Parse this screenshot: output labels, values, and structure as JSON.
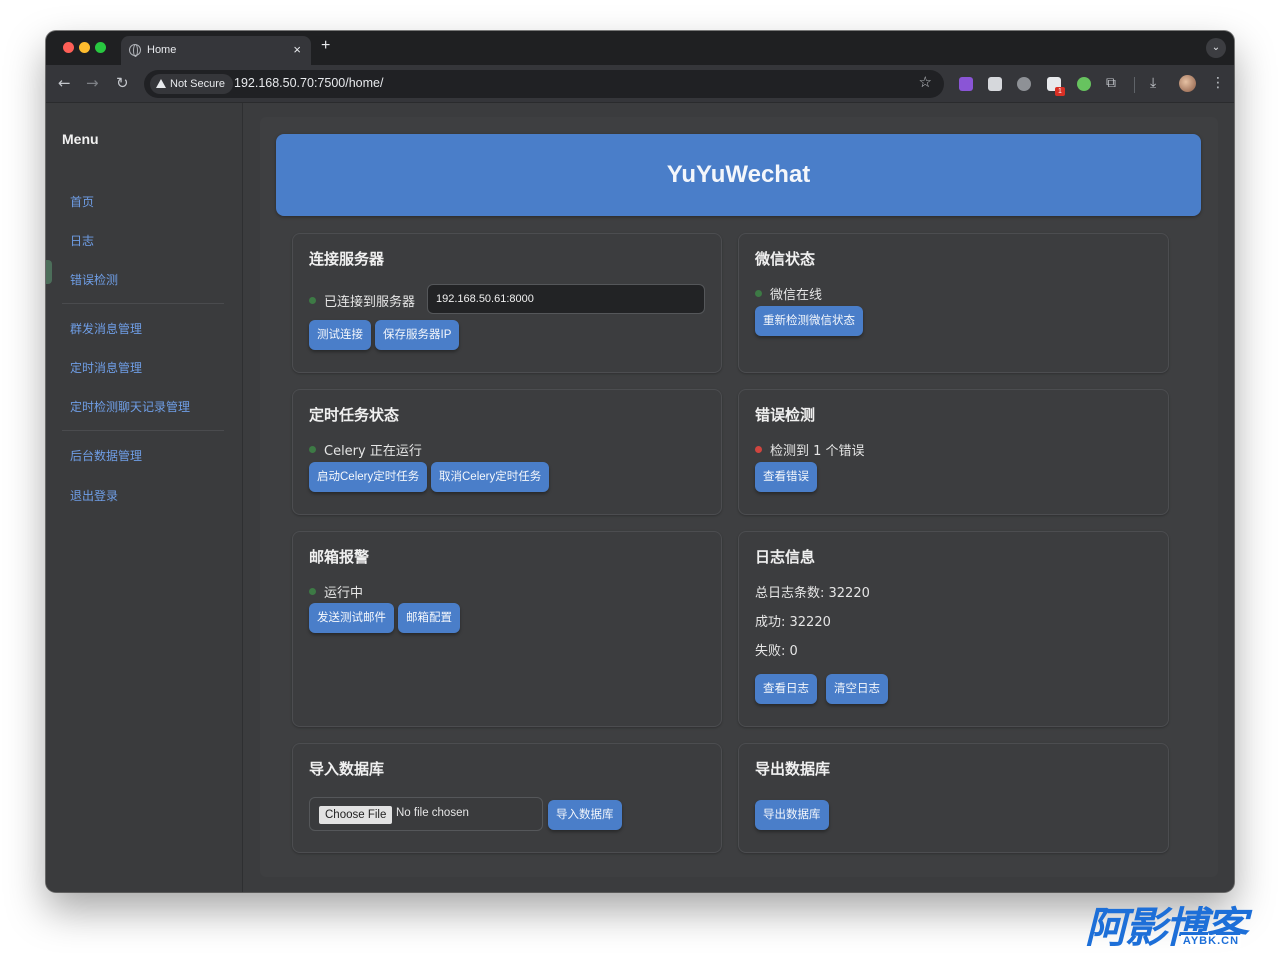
{
  "browser": {
    "tab_title": "Home",
    "tab_close": "×",
    "new_tab": "+",
    "tab_menu": "⌄",
    "security_label": "Not Secure",
    "url": "192.168.50.70:7500/home/",
    "extension_badge": "1"
  },
  "sidebar": {
    "title": "Menu",
    "items": [
      {
        "label": "首页"
      },
      {
        "label": "日志"
      },
      {
        "label": "错误检测"
      },
      {
        "label": "群发消息管理"
      },
      {
        "label": "定时消息管理"
      },
      {
        "label": "定时检测聊天记录管理"
      },
      {
        "label": "后台数据管理"
      },
      {
        "label": "退出登录"
      }
    ]
  },
  "banner": {
    "title": "YuYuWechat"
  },
  "cards": {
    "server": {
      "title": "连接服务器",
      "status": "已连接到服务器",
      "status_color": "#3d7a45",
      "input_value": "192.168.50.61:8000",
      "btn_test": "测试连接",
      "btn_save": "保存服务器IP"
    },
    "wechat": {
      "title": "微信状态",
      "status": "微信在线",
      "btn_recheck": "重新检测微信状态"
    },
    "celery": {
      "title": "定时任务状态",
      "status": "Celery 正在运行",
      "btn_start": "启动Celery定时任务",
      "btn_cancel": "取消Celery定时任务"
    },
    "errors": {
      "title": "错误检测",
      "status": "检测到 1 个错误",
      "status_color": "#d0453f",
      "btn_view": "查看错误"
    },
    "mail": {
      "title": "邮箱报警",
      "status": "运行中",
      "btn_send_test": "发送测试邮件",
      "btn_config": "邮箱配置"
    },
    "logs": {
      "title": "日志信息",
      "total": "总日志条数: 32220",
      "success": "成功: 32220",
      "failed": "失败: 0",
      "btn_view": "查看日志",
      "btn_clear": "清空日志"
    },
    "import_db": {
      "title": "导入数据库",
      "choose_file": "Choose File",
      "file_name": "No file chosen",
      "btn_import": "导入数据库"
    },
    "export_db": {
      "title": "导出数据库",
      "btn_export": "导出数据库"
    }
  },
  "watermark": {
    "cn": "阿影博客",
    "en": "AYBK.CN"
  },
  "colors": {
    "accent": "#4a7ec9",
    "link": "#6f9ee6",
    "background": "#3b3c3e"
  }
}
